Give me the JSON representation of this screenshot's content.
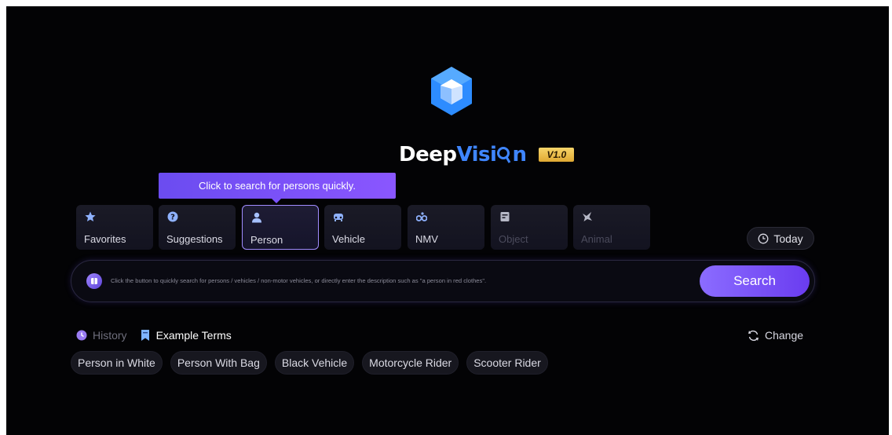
{
  "brand": {
    "name_part1": "Deep",
    "name_part2": "Visi",
    "name_part3": "n",
    "version": "V1.0"
  },
  "tooltip": {
    "text": "Click to search for persons quickly."
  },
  "categories": [
    {
      "label": "Favorites",
      "icon": "star-icon",
      "state": "normal"
    },
    {
      "label": "Suggestions",
      "icon": "question-icon",
      "state": "normal"
    },
    {
      "label": "Person",
      "icon": "person-icon",
      "state": "active"
    },
    {
      "label": "Vehicle",
      "icon": "car-icon",
      "state": "normal"
    },
    {
      "label": "NMV",
      "icon": "bicycle-icon",
      "state": "normal"
    },
    {
      "label": "Object",
      "icon": "object-icon",
      "state": "disabled"
    },
    {
      "label": "Animal",
      "icon": "animal-icon",
      "state": "disabled"
    }
  ],
  "time_filter": {
    "label": "Today",
    "icon": "clock-icon"
  },
  "search": {
    "placeholder": "Click the button to quickly search for persons / vehicles / non-motor vehicles, or directly enter the description such as \"a person in red clothes\".",
    "button_label": "Search"
  },
  "tabs": {
    "history": "History",
    "example_terms": "Example Terms"
  },
  "change_label": "Change",
  "example_terms": [
    "Person in White",
    "Person With Bag",
    "Black Vehicle",
    "Motorcycle Rider",
    "Scooter Rider"
  ],
  "colors": {
    "accent": "#7a52fa",
    "brand_blue": "#3f86ff",
    "version_gold": "#f0c44e"
  }
}
